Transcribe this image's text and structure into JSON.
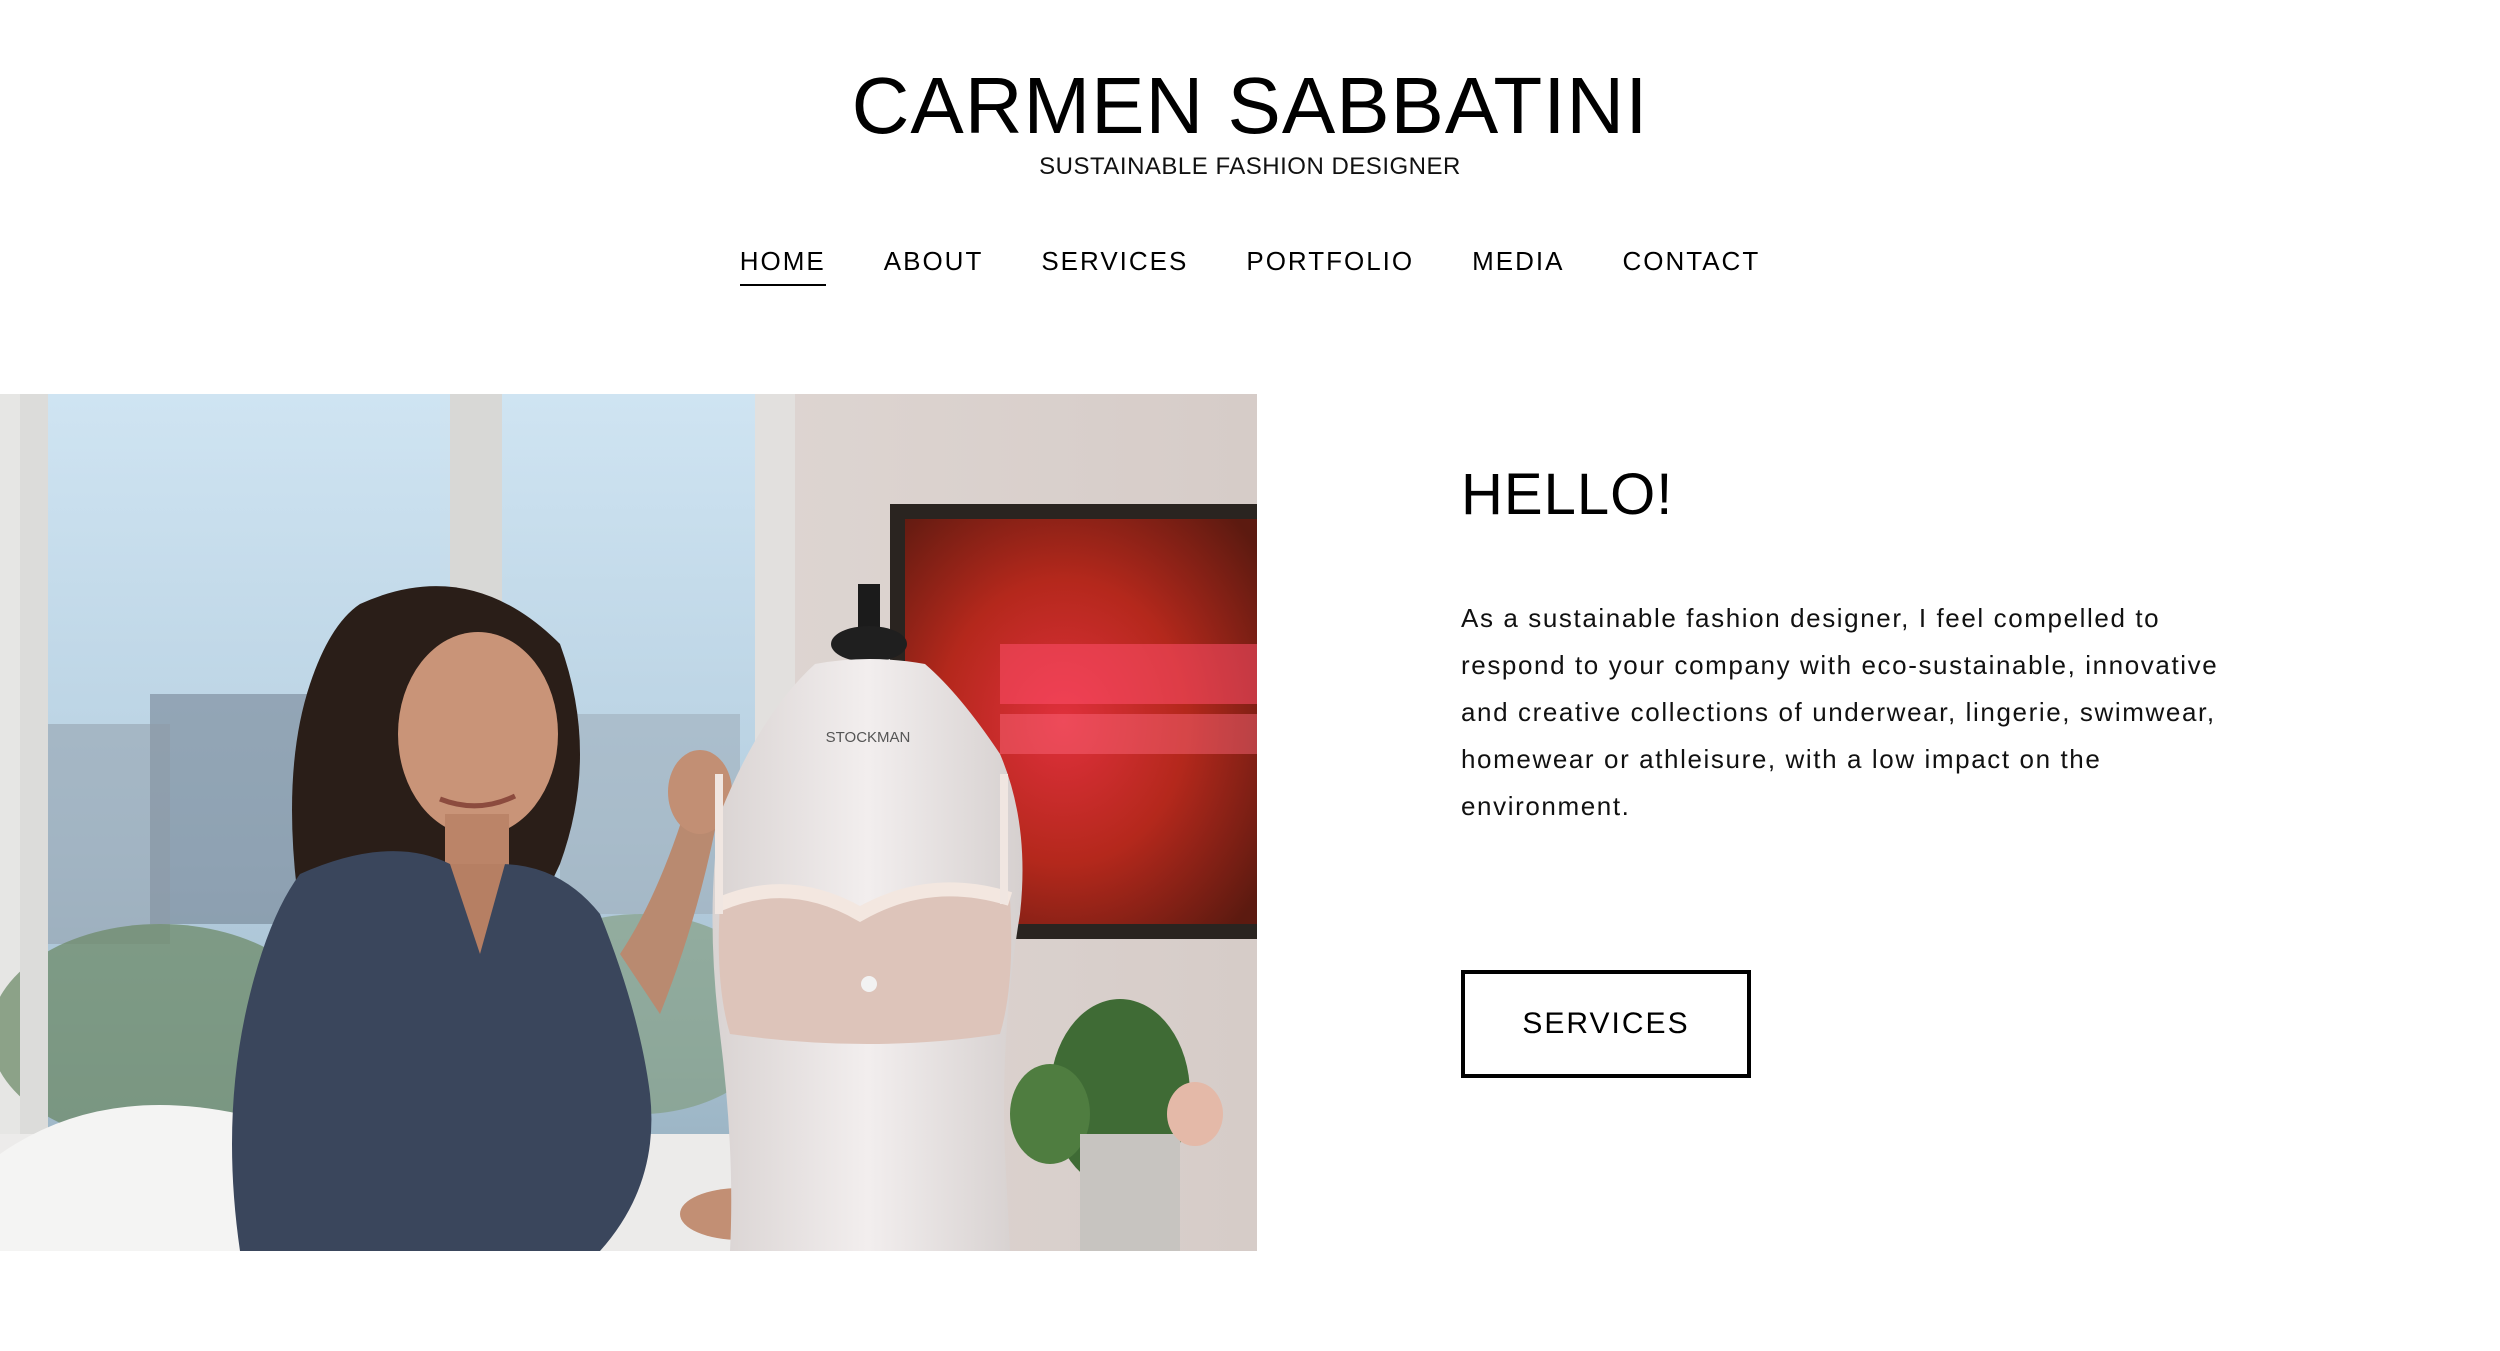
{
  "header": {
    "title": "CARMEN SABBATINI",
    "tagline": "SUSTAINABLE FASHION DESIGNER"
  },
  "nav": {
    "items": [
      {
        "label": "HOME",
        "active": true
      },
      {
        "label": "ABOUT",
        "active": false
      },
      {
        "label": "SERVICES",
        "active": false
      },
      {
        "label": "PORTFOLIO",
        "active": false
      },
      {
        "label": "MEDIA",
        "active": false
      },
      {
        "label": "CONTACT",
        "active": false
      }
    ]
  },
  "hero": {
    "mannequin_brand": "STOCKMAN"
  },
  "intro": {
    "heading": "HELLO!",
    "text": "As a sustainable fashion designer, I feel compelled to respond to your company with eco-sustainable, innovative and creative collections of underwear, lingerie, swimwear, homewear or athleisure, with a low impact on the environment.",
    "button_label": "SERVICES"
  },
  "colors": {
    "background": "#ffffff",
    "text": "#000000",
    "accent_red": "#c8232e"
  }
}
